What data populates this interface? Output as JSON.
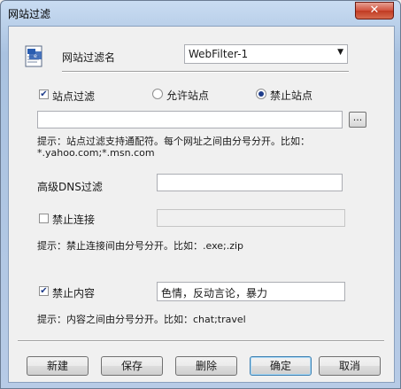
{
  "window": {
    "title": "网站过滤",
    "close_glyph": "✕"
  },
  "header": {
    "filter_name_label": "网站过滤名",
    "filter_name_value": "WebFilter-1"
  },
  "site_filter": {
    "label": "站点过滤",
    "checked": true,
    "allow_label": "允许站点",
    "block_label": "禁止站点",
    "selected": "block",
    "sites_value": "",
    "browse_label": "...",
    "hint_line1": "提示：站点过滤支持通配符。每个网址之间由分号分开。比如：",
    "hint_line2": "*.yahoo.com;*.msn.com"
  },
  "dns_filter": {
    "label": "高级DNS过滤",
    "value": ""
  },
  "block_conn": {
    "label": "禁止连接",
    "checked": false,
    "value": "",
    "hint": "提示：禁止连接间由分号分开。比如：.exe;.zip"
  },
  "block_content": {
    "label": "禁止内容",
    "checked": true,
    "value": "色情，反动言论，暴力",
    "hint": "提示：内容之间由分号分开。比如：chat;travel"
  },
  "buttons": {
    "new": "新建",
    "save": "保存",
    "delete": "删除",
    "ok": "确定",
    "cancel": "取消"
  },
  "icons": {
    "check": "✔",
    "doc": "document-icon",
    "dropdown": "chevron-down-icon"
  }
}
